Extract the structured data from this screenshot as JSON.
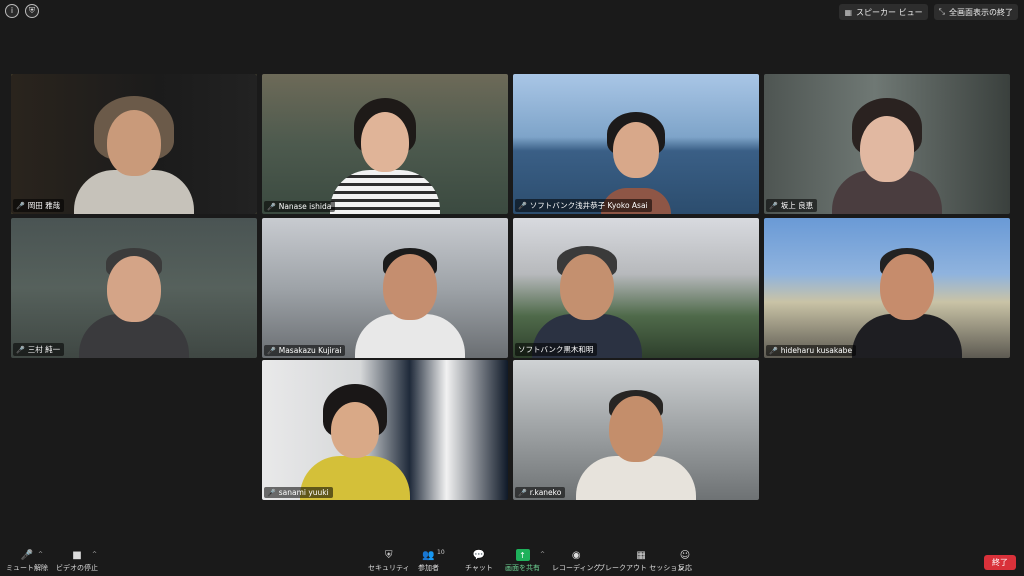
{
  "topbar": {
    "info_glyph": "i",
    "shield_glyph": "⛨",
    "speaker_view_label": "スピーカー ビュー",
    "fullscreen_exit_label": "全画面表示の終了"
  },
  "participants": [
    {
      "name": "岡田 雅哉",
      "muted": true,
      "active": true
    },
    {
      "name": "Nanase ishida",
      "muted": true,
      "active": false
    },
    {
      "name": "ソフトバンク浅井恭子 Kyoko Asai",
      "muted": true,
      "active": false
    },
    {
      "name": "坂上 良恵",
      "muted": true,
      "active": false
    },
    {
      "name": "三村 純一",
      "muted": true,
      "active": false
    },
    {
      "name": "Masakazu Kujirai",
      "muted": true,
      "active": false
    },
    {
      "name": "ソフトバンク黒木和明",
      "muted": false,
      "active": false
    },
    {
      "name": "hideharu kusakabe",
      "muted": true,
      "active": false
    },
    {
      "name": "sanami yuuki",
      "muted": true,
      "active": false
    },
    {
      "name": "r.kaneko",
      "muted": true,
      "active": false
    }
  ],
  "toolbar": {
    "unmute_label": "ミュート解除",
    "stop_video_label": "ビデオの停止",
    "security_label": "セキュリティ",
    "participants_label": "参加者",
    "participants_count": "10",
    "chat_label": "チャット",
    "share_screen_label": "画面を共有",
    "record_label": "レコーディング",
    "breakout_label": "ブレークアウト セッション",
    "reactions_label": "反応",
    "end_label": "終了"
  }
}
